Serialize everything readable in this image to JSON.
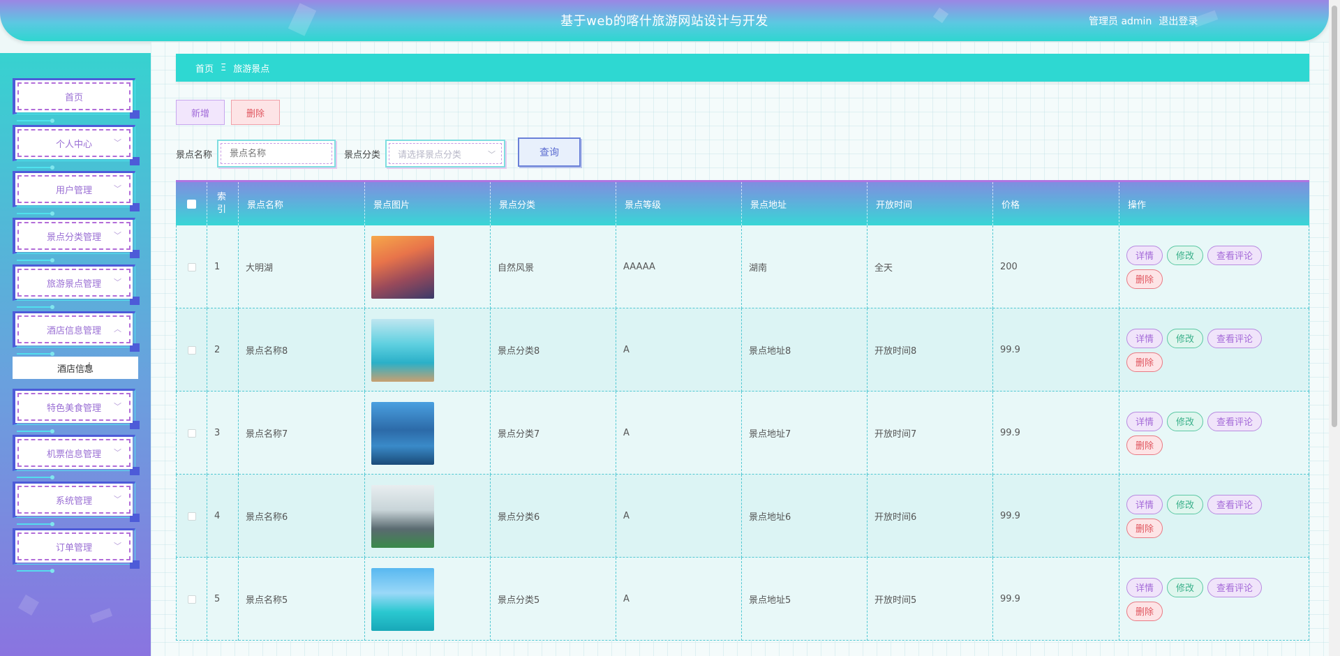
{
  "header": {
    "title": "基于web的喀什旅游网站设计与开发",
    "role": "管理员 admin",
    "logout": "退出登录"
  },
  "sidebar": {
    "items": [
      {
        "label": "首页",
        "has_chevron": false
      },
      {
        "label": "个人中心",
        "has_chevron": true
      },
      {
        "label": "用户管理",
        "has_chevron": true
      },
      {
        "label": "景点分类管理",
        "has_chevron": true
      },
      {
        "label": "旅游景点管理",
        "has_chevron": true
      },
      {
        "label": "酒店信息管理",
        "has_chevron": true,
        "expanded": true
      },
      {
        "label": "特色美食管理",
        "has_chevron": true
      },
      {
        "label": "机票信息管理",
        "has_chevron": true
      },
      {
        "label": "系统管理",
        "has_chevron": true
      },
      {
        "label": "订单管理",
        "has_chevron": true
      }
    ],
    "submenu": {
      "label": "酒店信息"
    }
  },
  "breadcrumb": {
    "home": "首页",
    "separator": "Ξ",
    "current": "旅游景点"
  },
  "toolbar": {
    "add_label": "新增",
    "delete_label": "删除"
  },
  "search": {
    "name_label": "景点名称",
    "name_placeholder": "景点名称",
    "category_label": "景点分类",
    "category_placeholder": "请选择景点分类",
    "query_label": "查询"
  },
  "table": {
    "headers": {
      "index": "索引",
      "name": "景点名称",
      "image": "景点图片",
      "category": "景点分类",
      "level": "景点等级",
      "address": "景点地址",
      "open_time": "开放时间",
      "price": "价格",
      "actions": "操作"
    },
    "action_labels": {
      "detail": "详情",
      "edit": "修改",
      "comment": "查看评论",
      "delete": "删除"
    },
    "rows": [
      {
        "index": "1",
        "name": "大明湖",
        "category": "自然风景",
        "level": "AAAAA",
        "address": "湖南",
        "open_time": "全天",
        "price": "200"
      },
      {
        "index": "2",
        "name": "景点名称8",
        "category": "景点分类8",
        "level": "A",
        "address": "景点地址8",
        "open_time": "开放时间8",
        "price": "99.9"
      },
      {
        "index": "3",
        "name": "景点名称7",
        "category": "景点分类7",
        "level": "A",
        "address": "景点地址7",
        "open_time": "开放时间7",
        "price": "99.9"
      },
      {
        "index": "4",
        "name": "景点名称6",
        "category": "景点分类6",
        "level": "A",
        "address": "景点地址6",
        "open_time": "开放时间6",
        "price": "99.9"
      },
      {
        "index": "5",
        "name": "景点名称5",
        "category": "景点分类5",
        "level": "A",
        "address": "景点地址5",
        "open_time": "开放时间5",
        "price": "99.9"
      }
    ]
  },
  "colors": {
    "header_gradient_top": "#9b86e4",
    "header_gradient_bottom": "#2ed6d0",
    "breadcrumb_bg": "#2ed8d2",
    "accent_purple": "#a46ad8",
    "danger": "#e0565f",
    "success": "#3ab08a"
  }
}
